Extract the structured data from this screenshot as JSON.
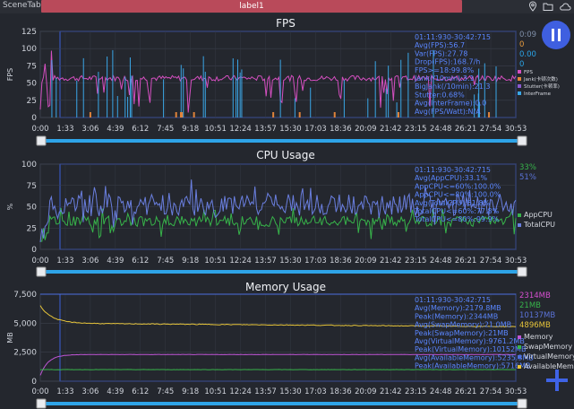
{
  "app": {
    "tab_label": "SceneTab",
    "title": "label1"
  },
  "icons": {
    "location": "location-pin-icon",
    "folder": "folder-icon",
    "cloud": "cloud-icon",
    "pause": "pause-icon",
    "add": "plus-icon"
  },
  "colors": {
    "accent": "#3f5fe0",
    "title_bar": "#b94a5a",
    "slider": "#2ea4e8"
  },
  "x_ticks": [
    "0:00",
    "1:33",
    "3:06",
    "4:39",
    "6:12",
    "7:45",
    "9:18",
    "10:51",
    "12:24",
    "13:57",
    "15:30",
    "17:03",
    "18:36",
    "20:09",
    "21:42",
    "23:15",
    "24:48",
    "26:21",
    "27:54",
    "30:53"
  ],
  "chart_data": [
    {
      "type": "line",
      "title": "FPS",
      "ylabel": "FPS",
      "ylim": [
        0,
        125
      ],
      "yticks": [
        0,
        25,
        50,
        75,
        100,
        125
      ],
      "x_range": [
        "0:00",
        "30:53"
      ],
      "stats": [
        "01:11:930-30:42:715",
        "Avg(FPS):56.7",
        "Var(FPS):27.78",
        "Drop(FPS):168.7/h",
        "FPS>=18:99.8%",
        "Jank(/10min):3.1",
        "BigJank(/10min):21.3",
        "Stutter:0.68%",
        "Avg(InterFrame):0.0",
        "Avg(FPS/Watt):N/A"
      ],
      "right_values": [
        {
          "text": "0:09",
          "color": "#7f8fa8"
        },
        {
          "text": "0",
          "color": "#e89a3c"
        },
        {
          "text": "0.00",
          "color": "#2aa3e6"
        },
        {
          "text": "0",
          "color": "#2aa3e6"
        }
      ],
      "series": [
        {
          "name": "FPS",
          "color": "#d44fc0",
          "typical": 57
        },
        {
          "name": "Jank(卡顿次数)",
          "color": "#e0833a"
        },
        {
          "name": "Stutter(卡顿率)",
          "color": "#8a5ad0"
        },
        {
          "name": "InterFrame",
          "color": "#3aa7e8"
        }
      ]
    },
    {
      "type": "line",
      "title": "CPU Usage",
      "ylabel": "%",
      "ylim": [
        0,
        100
      ],
      "yticks": [
        0,
        25,
        50,
        75,
        100
      ],
      "x_range": [
        "0:00",
        "30:53"
      ],
      "stats": [
        "01:11:930-30:42:715",
        "Avg(AppCPU):33.1%",
        "AppCPU<=60%:100.0%",
        "AppCPU<=80%:100.0%",
        "Avg(TotalCPU):51.8%",
        "TotalCPU<=60%:77.8%",
        "TotalCPU<=80%:99.9%"
      ],
      "right_values": [
        {
          "text": "33%",
          "color": "#37b34a"
        },
        {
          "text": "51%",
          "color": "#5b73d8"
        }
      ],
      "series": [
        {
          "name": "AppCPU",
          "color": "#37b34a",
          "typical": 33
        },
        {
          "name": "TotalCPU",
          "color": "#6a7fe0",
          "typical": 52
        }
      ]
    },
    {
      "type": "line",
      "title": "Memory Usage",
      "ylabel": "MB",
      "ylim": [
        0,
        7500
      ],
      "yticks": [
        0,
        2500,
        5000,
        7500
      ],
      "x_range": [
        "0:00",
        "30:53"
      ],
      "stats": [
        "01:11:930-30:42:715",
        "Avg(Memory):2179.8MB",
        "Peak(Memory):2344MB",
        "Avg(SwapMemory):21.0MB",
        "Peak(SwapMemory):21MB",
        "Avg(VirtualMemory):9761.2MB",
        "Peak(VirtualMemory):10152MB",
        "Avg(AvailableMemory):5235.3MB",
        "Peak(AvailableMemory):5716MB"
      ],
      "right_values": [
        {
          "text": "2314MB",
          "color": "#d64fd0"
        },
        {
          "text": "21MB",
          "color": "#37b34a"
        },
        {
          "text": "10137MB",
          "color": "#5b73d8"
        },
        {
          "text": "4896MB",
          "color": "#e6c43a"
        }
      ],
      "series": [
        {
          "name": "Memory",
          "color": "#c055d6",
          "typical": 2180
        },
        {
          "name": "SwapMemory",
          "color": "#37b34a",
          "typical": 21
        },
        {
          "name": "VirtualMemory",
          "color": "#4c6fe0",
          "typical": 9761
        },
        {
          "name": "AvailableMemory",
          "color": "#e6c43a",
          "typical": 5235
        }
      ]
    }
  ]
}
